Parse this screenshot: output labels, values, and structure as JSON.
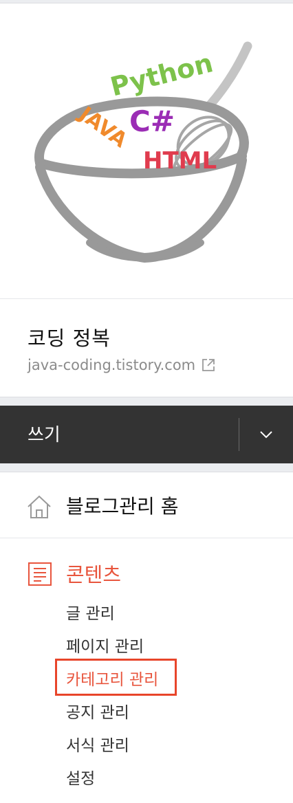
{
  "blog": {
    "title": "코딩 정복",
    "url": "java-coding.tistory.com",
    "logo_words": [
      "Python",
      "C#",
      "JAVA",
      "HTML"
    ]
  },
  "write_bar": {
    "label": "쓰기",
    "dropdown_icon": "chevron-down-icon"
  },
  "menu": {
    "home_label": "블로그관리 홈",
    "home_icon": "house-icon",
    "section_label": "콘텐츠",
    "section_icon": "document-list-icon",
    "items": [
      {
        "label": "글 관리",
        "active": false
      },
      {
        "label": "페이지 관리",
        "active": false
      },
      {
        "label": "카테고리 관리",
        "active": true
      },
      {
        "label": "공지 관리",
        "active": false
      },
      {
        "label": "서식 관리",
        "active": false
      },
      {
        "label": "설정",
        "active": false
      }
    ]
  },
  "colors": {
    "accent": "#e8553d",
    "highlight_border": "#e8452a",
    "write_bar_bg": "#333333",
    "python": "#7dc24b",
    "csharp": "#9b2db5",
    "java": "#f08a2c",
    "html": "#e03c4e",
    "bowl": "#9a9a9a"
  }
}
